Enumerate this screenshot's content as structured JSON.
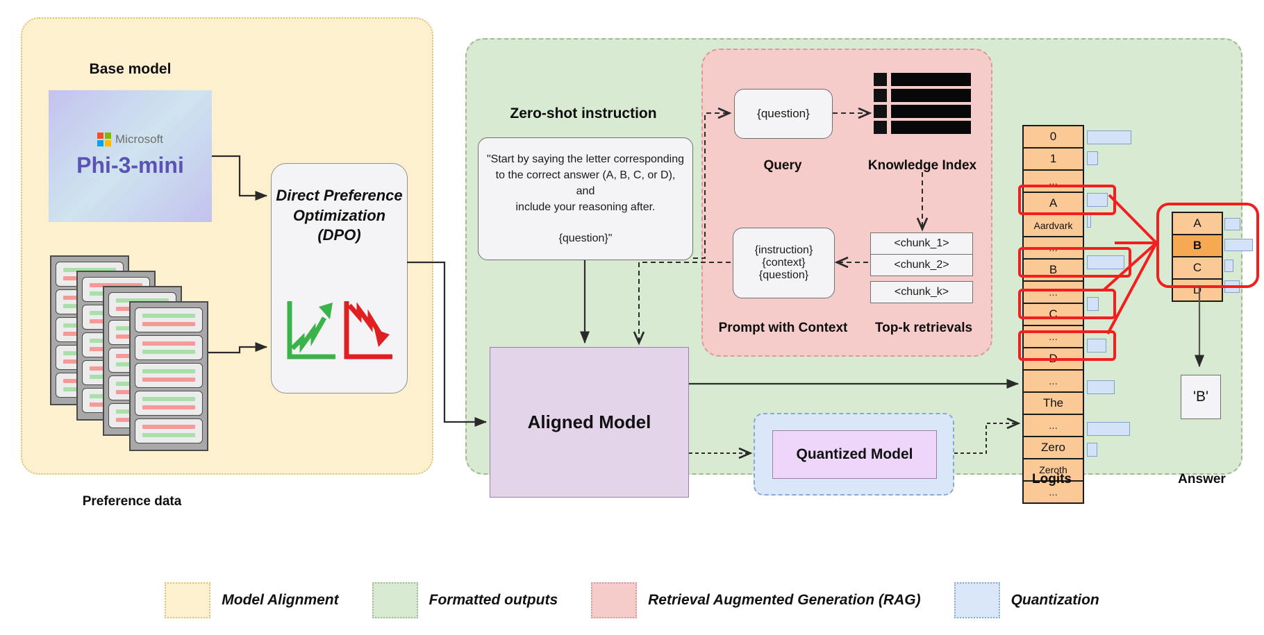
{
  "regions": {
    "model_alignment": "Model Alignment",
    "formatted_outputs": "Formatted outputs",
    "rag": "Retrieval Augmented Generation (RAG)",
    "quantization": "Quantization"
  },
  "left": {
    "base_model_label": "Base model",
    "brand": "Microsoft",
    "model_name": "Phi-3-mini",
    "preference_data_label": "Preference data",
    "dpo_title_lines": [
      "Direct Preference",
      "Optimization",
      "(DPO)"
    ]
  },
  "middle": {
    "zero_shot_heading": "Zero-shot instruction",
    "instruction_lines": [
      "\"Start by saying the letter corresponding",
      "to the correct answer (A, B, C, or D), and",
      "include your reasoning after."
    ],
    "instruction_question": "{question}\"",
    "aligned_model": "Aligned Model",
    "quantized_model": "Quantized Model"
  },
  "rag": {
    "query_text": "{question}",
    "query_label": "Query",
    "knowledge_index_label": "Knowledge Index",
    "prompt_lines": [
      "{instruction}",
      "{context}",
      "{question}"
    ],
    "prompt_label": "Prompt with Context",
    "topk_label": "Top-k retrievals",
    "chunks": [
      "<chunk_1>",
      "<chunk_2>",
      "<chunk_k>"
    ]
  },
  "logits": {
    "label": "Logits",
    "rows": [
      {
        "token": "0",
        "bar": 62,
        "highlight": false
      },
      {
        "token": "1",
        "bar": 14,
        "highlight": false
      },
      {
        "token": "...",
        "bar": 0,
        "highlight": false
      },
      {
        "token": "A",
        "bar": 28,
        "highlight": true
      },
      {
        "token": "Aardvark",
        "bar": 4,
        "highlight": false
      },
      {
        "token": "...",
        "bar": 0,
        "highlight": false
      },
      {
        "token": "B",
        "bar": 52,
        "highlight": true
      },
      {
        "token": "...",
        "bar": 0,
        "highlight": false
      },
      {
        "token": "C",
        "bar": 15,
        "highlight": true
      },
      {
        "token": "...",
        "bar": 0,
        "highlight": false
      },
      {
        "token": "D",
        "bar": 26,
        "highlight": true
      },
      {
        "token": "...",
        "bar": 0,
        "highlight": false
      },
      {
        "token": "The",
        "bar": 38,
        "highlight": false
      },
      {
        "token": "...",
        "bar": 0,
        "highlight": false
      },
      {
        "token": "Zero",
        "bar": 60,
        "highlight": false
      },
      {
        "token": "Zeroth",
        "bar": 13,
        "highlight": false
      },
      {
        "token": "...",
        "bar": 0,
        "highlight": false
      }
    ]
  },
  "answer": {
    "label": "Answer",
    "candidates": [
      {
        "token": "A",
        "bar": 28,
        "selected": false
      },
      {
        "token": "B",
        "bar": 52,
        "selected": true
      },
      {
        "token": "C",
        "bar": 15,
        "selected": false
      },
      {
        "token": "D",
        "bar": 26,
        "selected": false
      }
    ],
    "final": "'B'"
  },
  "colors": {
    "alignment_fill": "#fdf0cf",
    "formatted_fill": "#d8ead1",
    "rag_fill": "#f6ccca",
    "quantization_fill": "#dae7f8",
    "highlight_red": "#f31e1e",
    "selected_orange": "#f7a852",
    "token_orange": "#fbc995",
    "bar_blue": "#d3e2f7",
    "model_purple": "#e4d4ea",
    "quant_purple": "#edd6fa",
    "up_trend_green": "#3bb34a",
    "down_trend_red": "#e02020"
  }
}
